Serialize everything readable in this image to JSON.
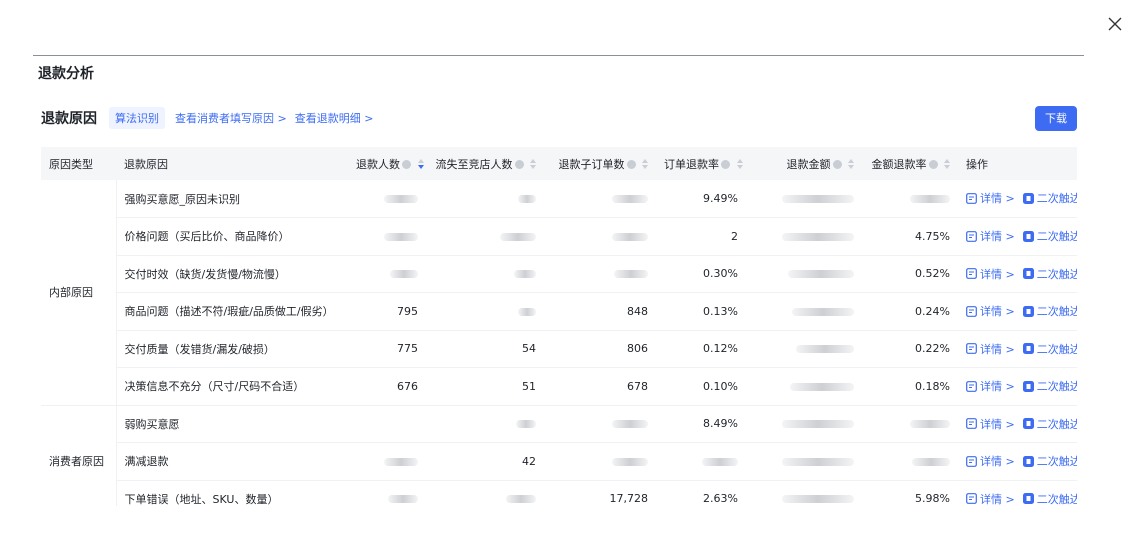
{
  "dialog": {
    "close_icon": "close-icon"
  },
  "panel": {
    "title": "退款分析"
  },
  "section": {
    "title": "退款原因",
    "algo_tag": "算法识别",
    "link_consumer_reason": "查看消费者填写原因 >",
    "link_refund_detail": "查看退款明细 >",
    "download_label": "下载"
  },
  "table": {
    "headers": {
      "reason_type": "原因类型",
      "reason": "退款原因",
      "refund_people": "退款人数",
      "lost_people": "流失至竞店人数",
      "refund_suborders": "退款子订单数",
      "order_refund_rate": "订单退款率",
      "refund_amount": "退款金额",
      "amount_refund_rate": "金额退款率",
      "actions": "操作"
    },
    "groups": {
      "internal": "内部原因",
      "consumer": "消费者原因"
    },
    "rows": [
      {
        "reason": "强购买意愿_原因未识别",
        "refund_people": "",
        "lost_people": "",
        "suborders": "",
        "order_rate": "9.49%",
        "amount": "",
        "amount_rate": ""
      },
      {
        "reason": "价格问题（买后比价、商品降价）",
        "refund_people": "",
        "lost_people": "",
        "suborders": "",
        "order_rate": "2",
        "amount": "",
        "amount_rate": "4.75%"
      },
      {
        "reason": "交付时效（缺货/发货慢/物流慢）",
        "refund_people": "",
        "lost_people": "",
        "suborders": "",
        "order_rate": "0.30%",
        "amount": "",
        "amount_rate": "0.52%"
      },
      {
        "reason": "商品问题（描述不符/瑕疵/品质做工/假劣）",
        "refund_people": "795",
        "lost_people": "",
        "suborders": "848",
        "order_rate": "0.13%",
        "amount": "",
        "amount_rate": "0.24%"
      },
      {
        "reason": "交付质量（发错货/漏发/破损）",
        "refund_people": "775",
        "lost_people": "54",
        "suborders": "806",
        "order_rate": "0.12%",
        "amount": "",
        "amount_rate": "0.22%"
      },
      {
        "reason": "决策信息不充分（尺寸/尺码不合适）",
        "refund_people": "676",
        "lost_people": "51",
        "suborders": "678",
        "order_rate": "0.10%",
        "amount": "",
        "amount_rate": "0.18%"
      },
      {
        "reason": "弱购买意愿",
        "refund_people": "",
        "lost_people": "",
        "suborders": "",
        "order_rate": "8.49%",
        "amount": "",
        "amount_rate": ""
      },
      {
        "reason": "满减退款",
        "refund_people": "",
        "lost_people": "42",
        "suborders": "",
        "order_rate": "",
        "amount": "",
        "amount_rate": ""
      },
      {
        "reason": "下单错误（地址、SKU、数量）",
        "refund_people": "",
        "lost_people": "",
        "suborders": "17,728",
        "order_rate": "2.63%",
        "amount": "",
        "amount_rate": "5.98%"
      }
    ],
    "actions": {
      "detail": "详情 >",
      "reach": "二次触达 >"
    }
  },
  "colors": {
    "accent": "#3d6cf2",
    "header_bg": "#f5f6f8"
  }
}
